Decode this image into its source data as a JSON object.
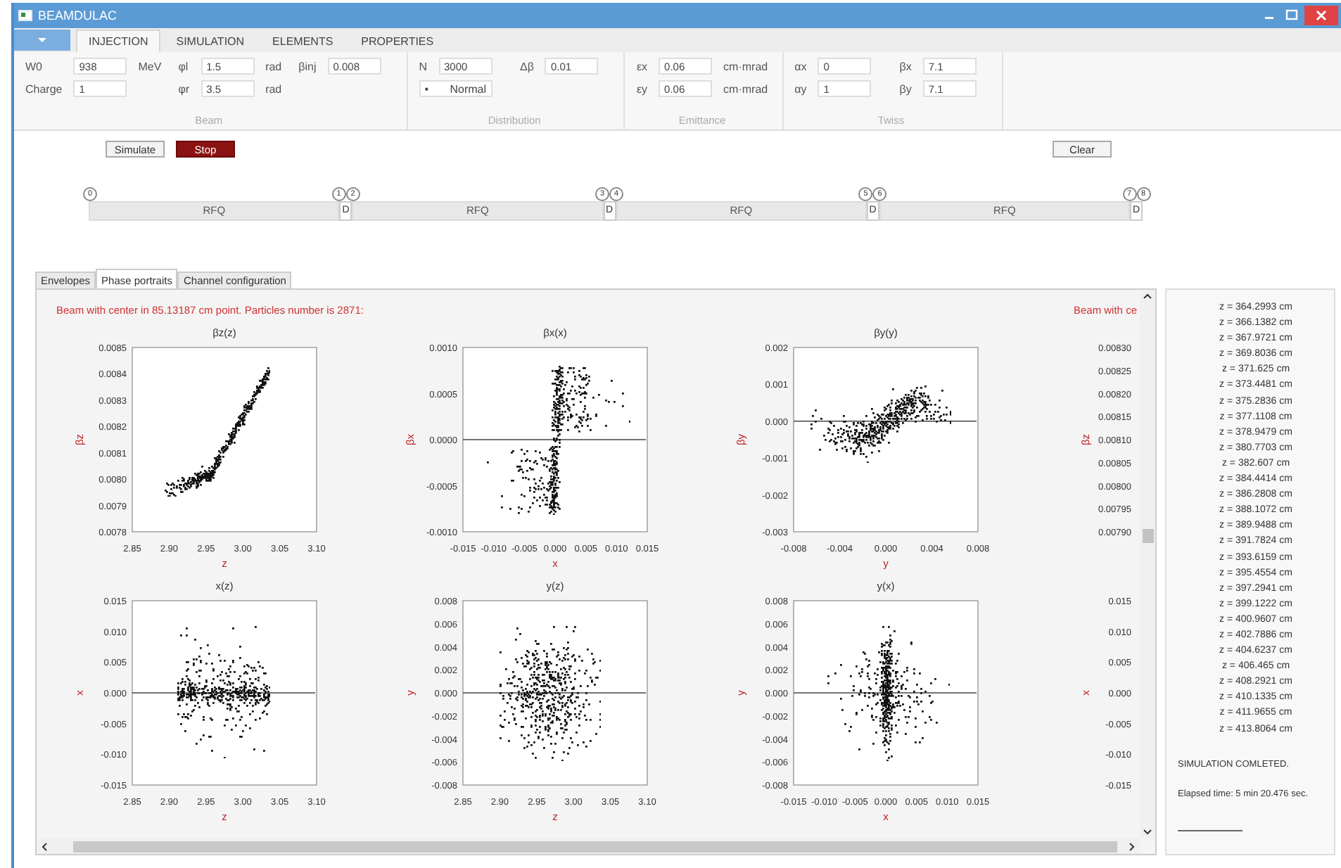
{
  "window": {
    "title": "BEAMDULAC"
  },
  "tabs": [
    {
      "label": "INJECTION",
      "selected": true
    },
    {
      "label": "SIMULATION",
      "selected": false
    },
    {
      "label": "ELEMENTS",
      "selected": false
    },
    {
      "label": "PROPERTIES",
      "selected": false
    }
  ],
  "ribbon": [
    {
      "label": "Beam",
      "columns": [
        [
          {
            "kind": "input",
            "label": "W0",
            "value": "938",
            "unit": "MeV"
          },
          {
            "kind": "input",
            "label": "Charge",
            "value": "1"
          }
        ],
        [
          {
            "kind": "input",
            "label": "φl",
            "value": "1.5",
            "unit": "rad"
          },
          {
            "kind": "input",
            "label": "φr",
            "value": "3.5",
            "unit": "rad"
          }
        ],
        [
          {
            "kind": "input",
            "label": "βinj",
            "value": "0.008"
          }
        ]
      ]
    },
    {
      "label": "Distribution",
      "columns": [
        [
          {
            "kind": "input",
            "label": "N",
            "value": "3000"
          },
          {
            "kind": "dropdown",
            "bullet": "•",
            "value": "Normal"
          }
        ],
        [
          {
            "kind": "input",
            "label": "Δβ",
            "value": "0.01"
          }
        ]
      ]
    },
    {
      "label": "Emittance",
      "columns": [
        [
          {
            "kind": "input",
            "label": "εx",
            "value": "0.06",
            "unit": "cm·mrad"
          },
          {
            "kind": "input",
            "label": "εy",
            "value": "0.06",
            "unit": "cm·mrad"
          }
        ]
      ]
    },
    {
      "label": "Twiss",
      "columns": [
        [
          {
            "kind": "input",
            "label": "αx",
            "value": "0"
          },
          {
            "kind": "input",
            "label": "αy",
            "value": "1"
          }
        ],
        [
          {
            "kind": "input",
            "label": "βx",
            "value": "7.1"
          },
          {
            "kind": "input",
            "label": "βy",
            "value": "7.1"
          }
        ]
      ]
    }
  ],
  "actions": [
    {
      "label": "Simulate",
      "kind": "default"
    },
    {
      "label": "Stop",
      "kind": "danger"
    }
  ],
  "clear_button": {
    "label": "Clear"
  },
  "lattice": [
    {
      "kind": "rfq",
      "label": "RFQ",
      "markers": [
        "0"
      ]
    },
    {
      "kind": "drift",
      "label": "D",
      "markers": [
        "1",
        "2"
      ]
    },
    {
      "kind": "rfq",
      "label": "RFQ"
    },
    {
      "kind": "drift",
      "label": "D",
      "markers": [
        "3",
        "4"
      ]
    },
    {
      "kind": "rfq",
      "label": "RFQ"
    },
    {
      "kind": "drift",
      "label": "D",
      "markers": [
        "5",
        "6"
      ]
    },
    {
      "kind": "rfq",
      "label": "RFQ"
    },
    {
      "kind": "drift",
      "label": "D",
      "markers": [
        "7",
        "8"
      ]
    }
  ],
  "view_tabs": [
    {
      "label": "Envelopes",
      "selected": false
    },
    {
      "label": "Phase portraits",
      "selected": true
    },
    {
      "label": "Channel configuration",
      "selected": false
    }
  ],
  "portraits": {
    "header": "Beam with center in 85.13187 cm point. Particles number is 2871:",
    "cut_header": "Beam with ce",
    "rows": [
      {
        "charts": [
          {
            "chart_data": {
              "type": "scatter",
              "title": "βz(z)",
              "xlabel": "z",
              "ylabel": "βz",
              "xlim": [
                2.85,
                3.1
              ],
              "ylim": [
                0.0078,
                0.0085
              ],
              "xticks": [
                {
                  "value": 2.85,
                  "label": "2.85"
                },
                {
                  "value": 2.9,
                  "label": "2.90"
                },
                {
                  "value": 2.95,
                  "label": "2.95"
                },
                {
                  "value": 3.0,
                  "label": "3.00"
                },
                {
                  "value": 3.05,
                  "label": "3.05"
                },
                {
                  "value": 3.1,
                  "label": "3.10"
                }
              ],
              "yticks": [
                {
                  "value": 0.0078,
                  "label": "0.0078"
                },
                {
                  "value": 0.0079,
                  "label": "0.0079"
                },
                {
                  "value": 0.008,
                  "label": "0.0080"
                },
                {
                  "value": 0.0081,
                  "label": "0.0081"
                },
                {
                  "value": 0.0082,
                  "label": "0.0082"
                },
                {
                  "value": 0.0083,
                  "label": "0.0083"
                },
                {
                  "value": 0.0084,
                  "label": "0.0084"
                },
                {
                  "value": 0.0085,
                  "label": "0.0085"
                }
              ]
            }
          },
          {
            "chart_data": {
              "type": "scatter",
              "title": "βx(x)",
              "xlabel": "x",
              "ylabel": "βx",
              "xlim": [
                -0.015,
                0.015
              ],
              "ylim": [
                -0.001,
                0.001
              ],
              "xticks": [
                {
                  "value": -0.015,
                  "label": "-0.015"
                },
                {
                  "value": -0.01,
                  "label": "-0.010"
                },
                {
                  "value": -0.005,
                  "label": "-0.005"
                },
                {
                  "value": 0,
                  "label": "0.000"
                },
                {
                  "value": 0.005,
                  "label": "0.005"
                },
                {
                  "value": 0.01,
                  "label": "0.010"
                },
                {
                  "value": 0.015,
                  "label": "0.015"
                }
              ],
              "yticks": [
                {
                  "value": -0.001,
                  "label": "-0.0010"
                },
                {
                  "value": -0.0005,
                  "label": "-0.0005"
                },
                {
                  "value": 0,
                  "label": "0.0000"
                },
                {
                  "value": 0.0005,
                  "label": "0.0005"
                },
                {
                  "value": 0.001,
                  "label": "0.0010"
                }
              ]
            }
          },
          {
            "chart_data": {
              "type": "scatter",
              "title": "βy(y)",
              "xlabel": "y",
              "ylabel": "βy",
              "xlim": [
                -0.008,
                0.008
              ],
              "ylim": [
                -0.003,
                0.002
              ],
              "xticks": [
                {
                  "value": -0.008,
                  "label": "-0.008"
                },
                {
                  "value": -0.004,
                  "label": "-0.004"
                },
                {
                  "value": 0,
                  "label": "0.000"
                },
                {
                  "value": 0.004,
                  "label": "0.004"
                },
                {
                  "value": 0.008,
                  "label": "0.008"
                }
              ],
              "yticks": [
                {
                  "value": -0.003,
                  "label": "-0.003"
                },
                {
                  "value": -0.002,
                  "label": "-0.002"
                },
                {
                  "value": -0.001,
                  "label": "-0.001"
                },
                {
                  "value": 0,
                  "label": "0.000"
                },
                {
                  "value": 0.001,
                  "label": "0.001"
                },
                {
                  "value": 0.002,
                  "label": "0.002"
                }
              ]
            }
          }
        ],
        "cut_plot": {
          "ylabel": "βz",
          "yticks": [
            "0.00830",
            "0.00825",
            "0.00820",
            "0.00815",
            "0.00810",
            "0.00805",
            "0.00800",
            "0.00795",
            "0.00790"
          ]
        }
      },
      {
        "charts": [
          {
            "chart_data": {
              "type": "scatter",
              "title": "x(z)",
              "xlabel": "z",
              "ylabel": "x",
              "xlim": [
                2.85,
                3.1
              ],
              "ylim": [
                -0.015,
                0.015
              ],
              "xticks": [
                {
                  "value": 2.85,
                  "label": "2.85"
                },
                {
                  "value": 2.9,
                  "label": "2.90"
                },
                {
                  "value": 2.95,
                  "label": "2.95"
                },
                {
                  "value": 3.0,
                  "label": "3.00"
                },
                {
                  "value": 3.05,
                  "label": "3.05"
                },
                {
                  "value": 3.1,
                  "label": "3.10"
                }
              ],
              "yticks": [
                {
                  "value": -0.015,
                  "label": "-0.015"
                },
                {
                  "value": -0.01,
                  "label": "-0.010"
                },
                {
                  "value": -0.005,
                  "label": "-0.005"
                },
                {
                  "value": 0,
                  "label": "0.000"
                },
                {
                  "value": 0.005,
                  "label": "0.005"
                },
                {
                  "value": 0.01,
                  "label": "0.010"
                },
                {
                  "value": 0.015,
                  "label": "0.015"
                }
              ]
            }
          },
          {
            "chart_data": {
              "type": "scatter",
              "title": "y(z)",
              "xlabel": "z",
              "ylabel": "y",
              "xlim": [
                2.85,
                3.1
              ],
              "ylim": [
                -0.008,
                0.008
              ],
              "xticks": [
                {
                  "value": 2.85,
                  "label": "2.85"
                },
                {
                  "value": 2.9,
                  "label": "2.90"
                },
                {
                  "value": 2.95,
                  "label": "2.95"
                },
                {
                  "value": 3.0,
                  "label": "3.00"
                },
                {
                  "value": 3.05,
                  "label": "3.05"
                },
                {
                  "value": 3.1,
                  "label": "3.10"
                }
              ],
              "yticks": [
                {
                  "value": -0.008,
                  "label": "-0.008"
                },
                {
                  "value": -0.006,
                  "label": "-0.006"
                },
                {
                  "value": -0.004,
                  "label": "-0.004"
                },
                {
                  "value": -0.002,
                  "label": "-0.002"
                },
                {
                  "value": 0,
                  "label": "0.000"
                },
                {
                  "value": 0.002,
                  "label": "0.002"
                },
                {
                  "value": 0.004,
                  "label": "0.004"
                },
                {
                  "value": 0.006,
                  "label": "0.006"
                },
                {
                  "value": 0.008,
                  "label": "0.008"
                }
              ]
            }
          },
          {
            "chart_data": {
              "type": "scatter",
              "title": "y(x)",
              "xlabel": "x",
              "ylabel": "y",
              "xlim": [
                -0.015,
                0.015
              ],
              "ylim": [
                -0.008,
                0.008
              ],
              "xticks": [
                {
                  "value": -0.015,
                  "label": "-0.015"
                },
                {
                  "value": -0.01,
                  "label": "-0.010"
                },
                {
                  "value": -0.005,
                  "label": "-0.005"
                },
                {
                  "value": 0,
                  "label": "0.000"
                },
                {
                  "value": 0.005,
                  "label": "0.005"
                },
                {
                  "value": 0.01,
                  "label": "0.010"
                },
                {
                  "value": 0.015,
                  "label": "0.015"
                }
              ],
              "yticks": [
                {
                  "value": -0.008,
                  "label": "-0.008"
                },
                {
                  "value": -0.006,
                  "label": "-0.006"
                },
                {
                  "value": -0.004,
                  "label": "-0.004"
                },
                {
                  "value": -0.002,
                  "label": "-0.002"
                },
                {
                  "value": 0,
                  "label": "0.000"
                },
                {
                  "value": 0.002,
                  "label": "0.002"
                },
                {
                  "value": 0.004,
                  "label": "0.004"
                },
                {
                  "value": 0.006,
                  "label": "0.006"
                },
                {
                  "value": 0.008,
                  "label": "0.008"
                }
              ]
            }
          }
        ],
        "cut_plot": {
          "ylabel": "x",
          "yticks": [
            "0.015",
            "0.010",
            "0.005",
            "0.000",
            "-0.005",
            "-0.010",
            "-0.015"
          ]
        }
      }
    ]
  },
  "log": {
    "lines": [
      "z = 364.2993 cm",
      "z = 366.1382 cm",
      "z = 367.9721 cm",
      "z = 369.8036 cm",
      "z = 371.625 cm",
      "z = 373.4481 cm",
      "z = 375.2836 cm",
      "z = 377.1108 cm",
      "z = 378.9479 cm",
      "z = 380.7703 cm",
      "z = 382.607 cm",
      "z = 384.4414 cm",
      "z = 386.2808 cm",
      "z = 388.1072 cm",
      "z = 389.9488 cm",
      "z = 391.7824 cm",
      "z = 393.6159 cm",
      "z = 395.4554 cm",
      "z = 397.2941 cm",
      "z = 399.1222 cm",
      "z = 400.9607 cm",
      "z = 402.7886 cm",
      "z = 404.6237 cm",
      "z = 406.465 cm",
      "z = 408.2921 cm",
      "z = 410.1335 cm",
      "z = 411.9655 cm",
      "z = 413.8064 cm"
    ],
    "status": "SIMULATION COMLETED.",
    "elapsed": "Elapsed time: 5 min 20.476 sec."
  }
}
